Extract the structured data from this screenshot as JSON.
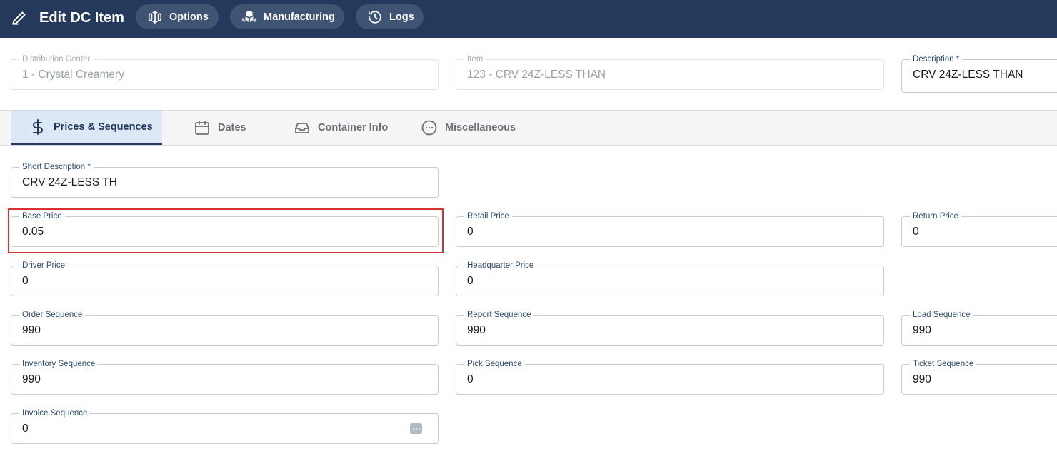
{
  "header": {
    "title": "Edit DC Item",
    "buttons": [
      {
        "label": "Options",
        "icon": "options-icon"
      },
      {
        "label": "Manufacturing",
        "icon": "manufacturing-icon"
      },
      {
        "label": "Logs",
        "icon": "history-icon"
      }
    ]
  },
  "top_fields": {
    "distribution_center": {
      "label": "Distribution Center",
      "value": "1 - Crystal Creamery"
    },
    "item": {
      "label": "Item",
      "value": "123 - CRV 24Z-LESS THAN"
    },
    "description": {
      "label": "Description *",
      "value": "CRV 24Z-LESS THAN"
    }
  },
  "tabs": [
    {
      "label": "Prices & Sequences",
      "icon": "dollar-icon",
      "active": true
    },
    {
      "label": "Dates",
      "icon": "calendar-icon",
      "active": false
    },
    {
      "label": "Container Info",
      "icon": "inbox-icon",
      "active": false
    },
    {
      "label": "Miscellaneous",
      "icon": "more-circle-icon",
      "active": false
    }
  ],
  "form": {
    "short_description": {
      "label": "Short Description *",
      "value": "CRV 24Z-LESS TH"
    },
    "base_price": {
      "label": "Base Price",
      "value": "0.05"
    },
    "retail_price": {
      "label": "Retail Price",
      "value": "0"
    },
    "return_price": {
      "label": "Return Price",
      "value": "0"
    },
    "driver_price": {
      "label": "Driver Price",
      "value": "0"
    },
    "headquarter_price": {
      "label": "Headquarter Price",
      "value": "0"
    },
    "order_sequence": {
      "label": "Order Sequence",
      "value": "990"
    },
    "report_sequence": {
      "label": "Report Sequence",
      "value": "990"
    },
    "load_sequence": {
      "label": "Load Sequence",
      "value": "990"
    },
    "inventory_sequence": {
      "label": "Inventory Sequence",
      "value": "990"
    },
    "pick_sequence": {
      "label": "Pick Sequence",
      "value": "0"
    },
    "ticket_sequence": {
      "label": "Ticket Sequence",
      "value": "990"
    },
    "invoice_sequence": {
      "label": "Invoice Sequence",
      "value": "0"
    }
  },
  "colors": {
    "header_bg": "#24395c",
    "pill_bg": "#3f5372",
    "active_tab_bg": "#dde8f6",
    "label_blue": "#2b4a73",
    "highlight_red": "#d93030"
  }
}
